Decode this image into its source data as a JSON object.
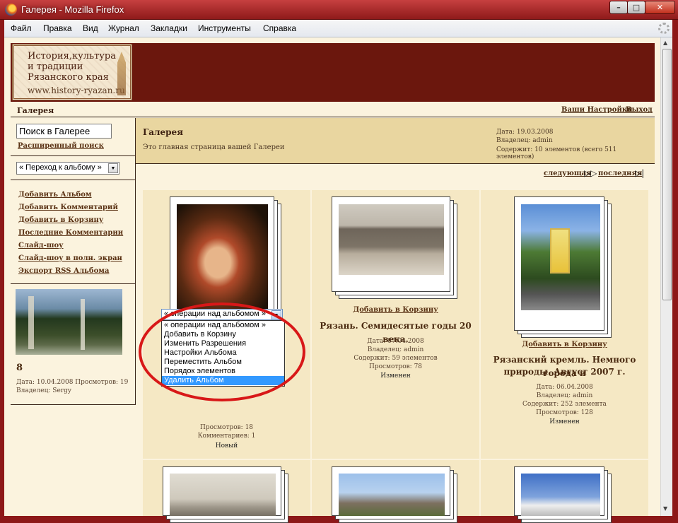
{
  "window": {
    "title": "Галерея - Mozilla Firefox",
    "min": "–",
    "max": "□",
    "close": "✕"
  },
  "menu": [
    "Файл",
    "Правка",
    "Вид",
    "Журнал",
    "Закладки",
    "Инструменты",
    "Справка"
  ],
  "logo": {
    "line1": "История,культура",
    "line2": "и традиции",
    "line3": "Рязанского края",
    "url": "www.history-ryazan.ru"
  },
  "topbar": {
    "crumb": "Галерея",
    "settings": "Ваши Настройки",
    "logout": "Выход"
  },
  "sidebar": {
    "search_value": "Поиск в Галерее",
    "advanced_search": "Расширенный поиск",
    "jump_select": "« Переход к альбому »",
    "links": [
      "Добавить Альбом",
      "Добавить Комментарий",
      "Добавить в Корзину",
      "Последние Комментарии",
      "Слайд-шоу",
      "Слайд-шоу в полн. экран",
      "Экспорт RSS Альбома"
    ],
    "thumb_title": "8",
    "thumb_date": "Дата: 10.04.2008 Просмотров: 19",
    "thumb_owner": "Владелец: Sergy"
  },
  "gallery": {
    "title": "Галерея",
    "description": "Это главная страница вашей Галереи",
    "date": "Дата: 19.03.2008",
    "owner": "Владелец: admin",
    "contains": "Содержит: 10 элементов (всего 511 элементов)"
  },
  "pager": {
    "next": "следующая",
    "last": "последняя",
    "next_icon": "▷▷",
    "last_icon": "▷|"
  },
  "albums": [
    {
      "views": "Просмотров: 18",
      "comments": "Комментариев: 1",
      "status": "Новый"
    },
    {
      "cart": "Добавить в Корзину",
      "title": "Рязань. Семидесятые годы 20 века.",
      "date": "Дата: 07.04.2008",
      "owner": "Владелец: admin",
      "contains": "Содержит: 59 элементов",
      "views": "Просмотров: 78",
      "status": "Изменен"
    },
    {
      "cart": "Добавить в Корзину",
      "title_l1": "Рязанский кремль. Немного города и",
      "title_l2": "природы. Август 2007 г.",
      "date": "Дата: 06.04.2008",
      "owner": "Владелец: admin",
      "contains": "Содержит: 252 элемента",
      "views": "Просмотров: 128",
      "status": "Изменен"
    }
  ],
  "ops_dropdown": {
    "selected": "« операции над альбомом »",
    "options": [
      "« операции над альбомом »",
      "Добавить в Корзину",
      "Изменить Разрешения",
      "Настройки Альбома",
      "Переместить Альбом",
      "Порядок элементов",
      "Удалить Альбом"
    ],
    "highlighted": "Удалить Альбом"
  },
  "colors": {
    "header": "#6b170d",
    "page_bg": "#fbf3de",
    "cell_bg": "#f5e8c4",
    "highlight": "#3399ff",
    "annotation": "#d81818"
  }
}
